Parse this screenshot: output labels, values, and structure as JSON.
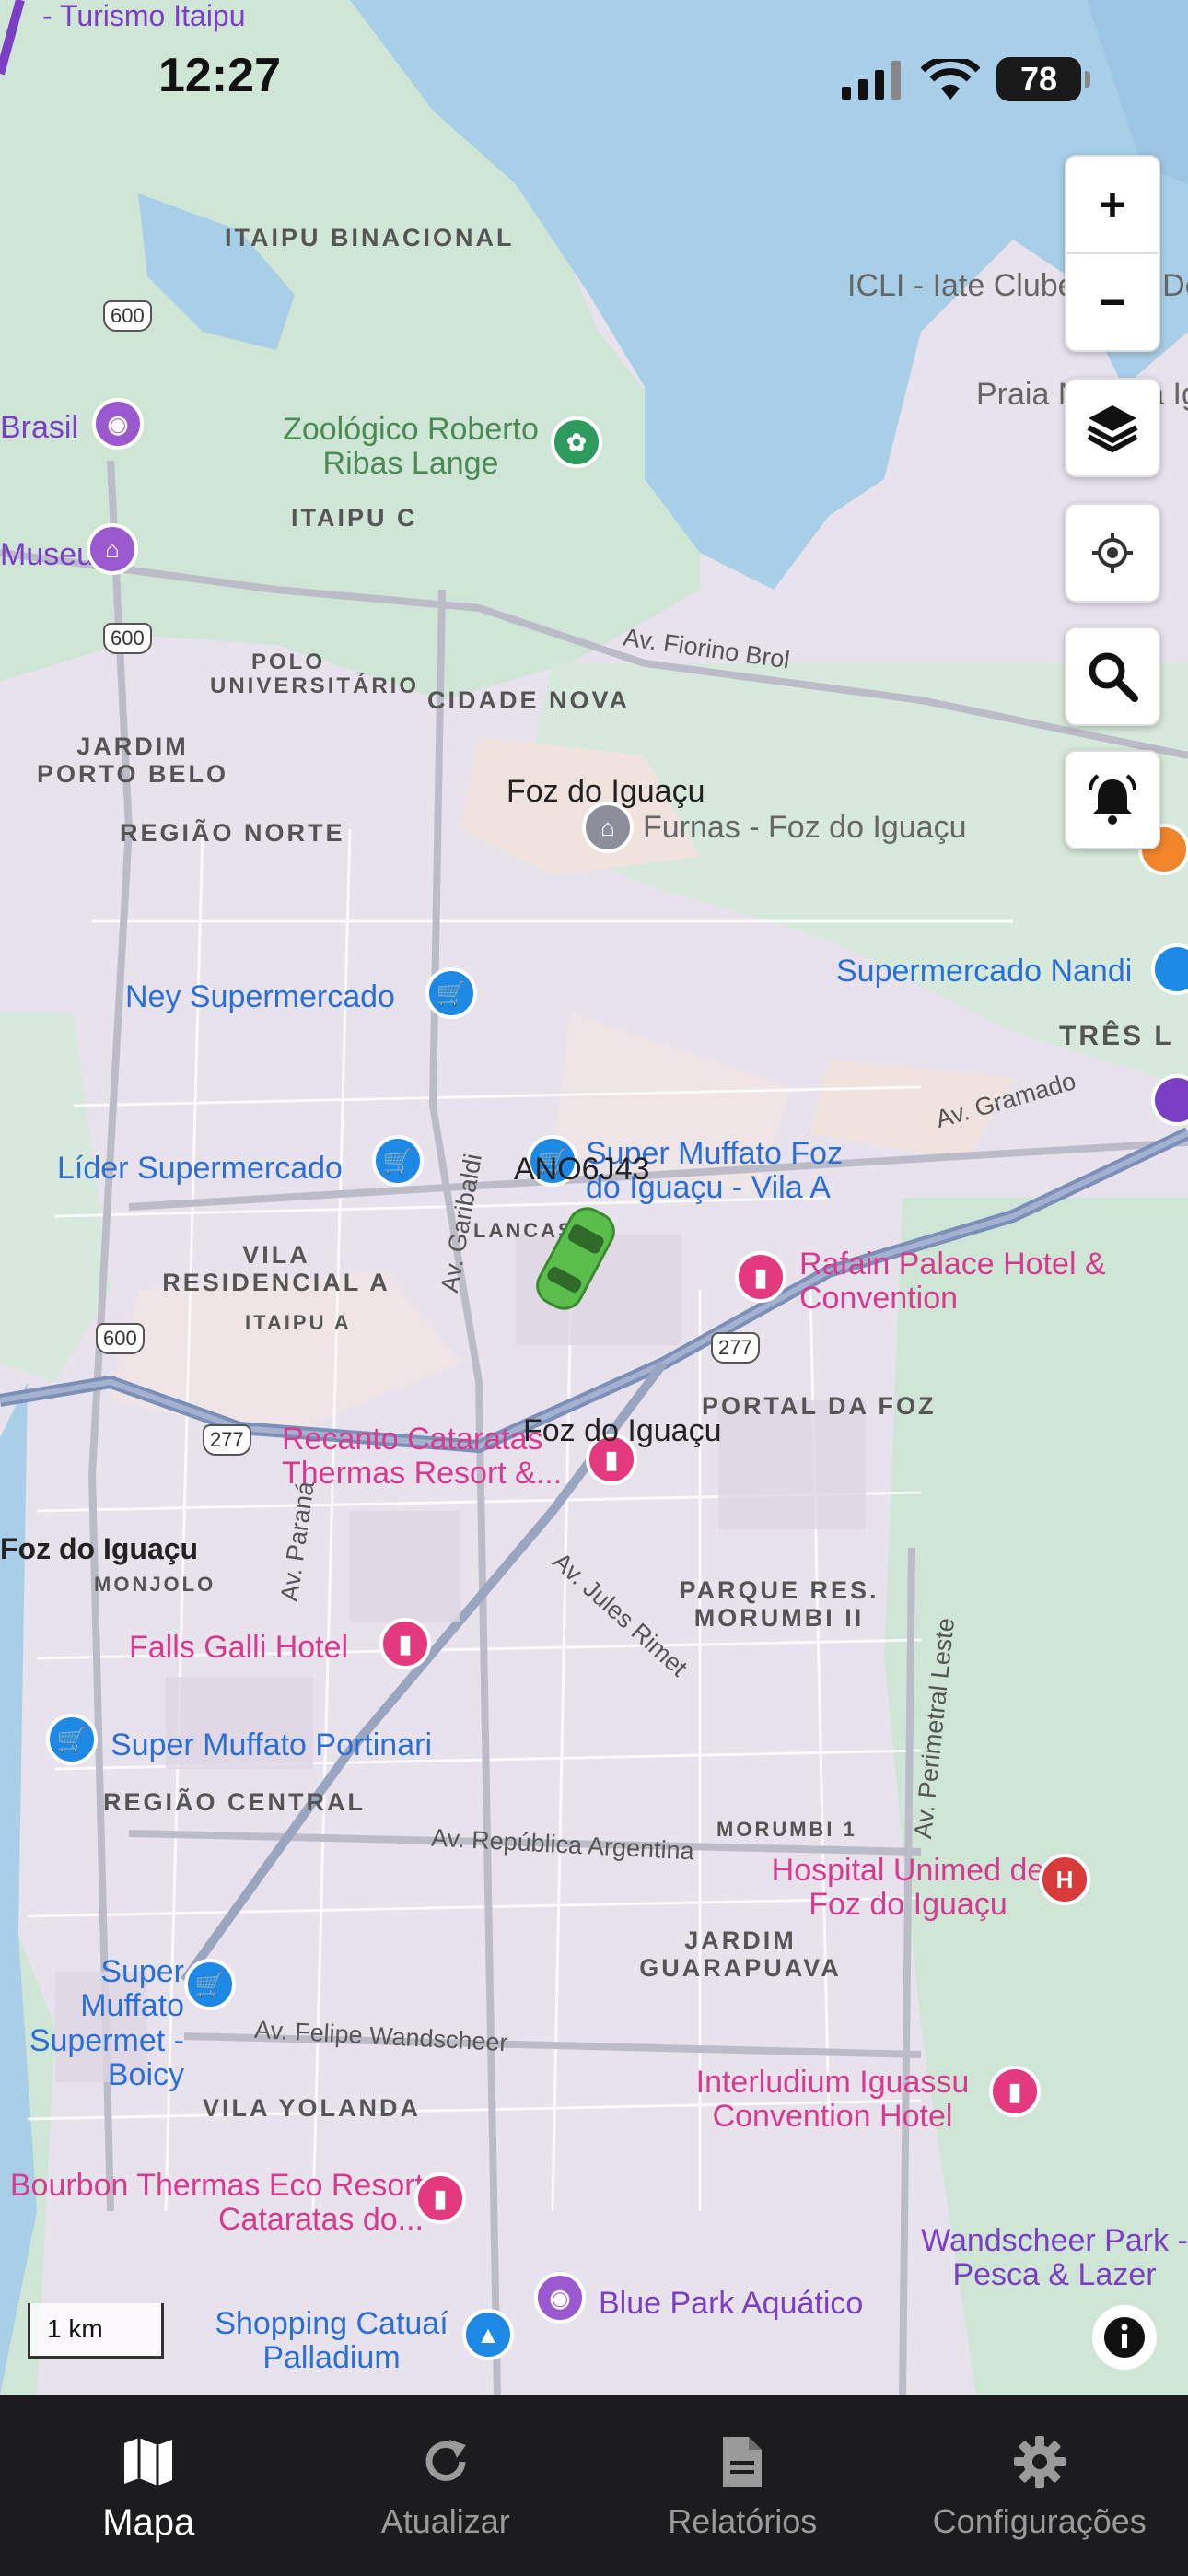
{
  "status_bar": {
    "time": "12:27",
    "battery": "78"
  },
  "map": {
    "vehicle_label": "ANO6J43",
    "city_labels": [
      "Foz do Iguaçu",
      "Foz do Iguaçu"
    ],
    "top_label": "Mirante de Vertedouro - Turismo Itaipu",
    "places": {
      "itaipu_binacional": "ITAIPU BINACIONAL",
      "iclí": "ICLI - Iate Clube Lago De Itaipu",
      "praia": "Praia Náutica Iguaçu",
      "brasil": "Brasil",
      "museu": "Museu",
      "zoologico": "Zoológico Roberto Ribas Lange",
      "itaipu_c": "ITAIPU C",
      "polo": "POLO UNIVERSITÁRIO",
      "cidade_nova": "CIDADE NOVA",
      "fiorino": "Av. Fiorino Brol",
      "jardim_porto_belo": "JARDIM PORTO BELO",
      "regiao_norte": "REGIÃO NORTE",
      "furnas": "Furnas - Foz do Iguaçu",
      "supermercado_nandi": "Supermercado Nandi",
      "ney": "Ney Supermercado",
      "tres": "TRÊS L",
      "gramado": "Av. Gramado",
      "lider": "Líder Supermercado",
      "super_muffato_foz": "Super Muffato Foz do Iguaçu - Vila A",
      "vila_residencial": "VILA RESIDENCIAL A",
      "lancas": "LANCAS",
      "itaipu_a": "ITAIPU A",
      "garibaldi": "Av. Garibaldi",
      "rafain": "Rafain Palace Hotel & Convention",
      "portal": "PORTAL DA FOZ",
      "recanto": "Recanto Cataratas Thermas Resort &...",
      "foz_left": "Foz do Iguaçu",
      "monjolo": "MONJOLO",
      "parana": "Av. Paraná",
      "jules": "Av. Jules Rimet",
      "parque": "PARQUE RES. MORUMBI II",
      "falls": "Falls Galli Hotel",
      "perimetral": "Av. Perimetral Leste",
      "super_muffato_portinari": "Super Muffato Portinari",
      "regiao_central": "REGIÃO CENTRAL",
      "republica": "Av. República Argentina",
      "morumbi": "MORUMBI 1",
      "hospital": "Hospital Unimed de Foz do Iguaçu",
      "jardim_guarapuava": "JARDIM GUARAPUAVA",
      "super_muffato_boicy": "Super Muffato Supermet - Boicy",
      "felipe": "Av. Felipe Wandscheer",
      "vila_yolanda": "VILA YOLANDA",
      "interludium": "Interludium Iguassu Convention Hotel",
      "bourbon": "Bourbon Thermas Eco Resort Cataratas do...",
      "wandscheer": "Wandscheer Park - Pesca & Lazer",
      "blue_park": "Blue Park Aquático",
      "catuai": "Shopping Catuaí Palladium"
    },
    "shields": [
      "600",
      "600",
      "600",
      "277",
      "277",
      "277"
    ],
    "scale": "1 km"
  },
  "controls": {
    "zoom_in": "+",
    "zoom_out": "−",
    "layers_icon": "layers-icon",
    "locate_icon": "locate-icon",
    "search_icon": "search-icon",
    "alarm_icon": "bell-alarm-icon"
  },
  "nav": {
    "items": [
      {
        "label": "Mapa",
        "icon": "map-icon",
        "active": true
      },
      {
        "label": "Atualizar",
        "icon": "refresh-icon",
        "active": false
      },
      {
        "label": "Relatórios",
        "icon": "document-icon",
        "active": false
      },
      {
        "label": "Configurações",
        "icon": "gear-icon",
        "active": false
      }
    ]
  },
  "colors": {
    "water": "#a9cfe8",
    "park": "#cfe6d6",
    "urban": "#e8e2ec",
    "nav_bg": "#1c1c1e",
    "vehicle": "#5bbd4b"
  }
}
